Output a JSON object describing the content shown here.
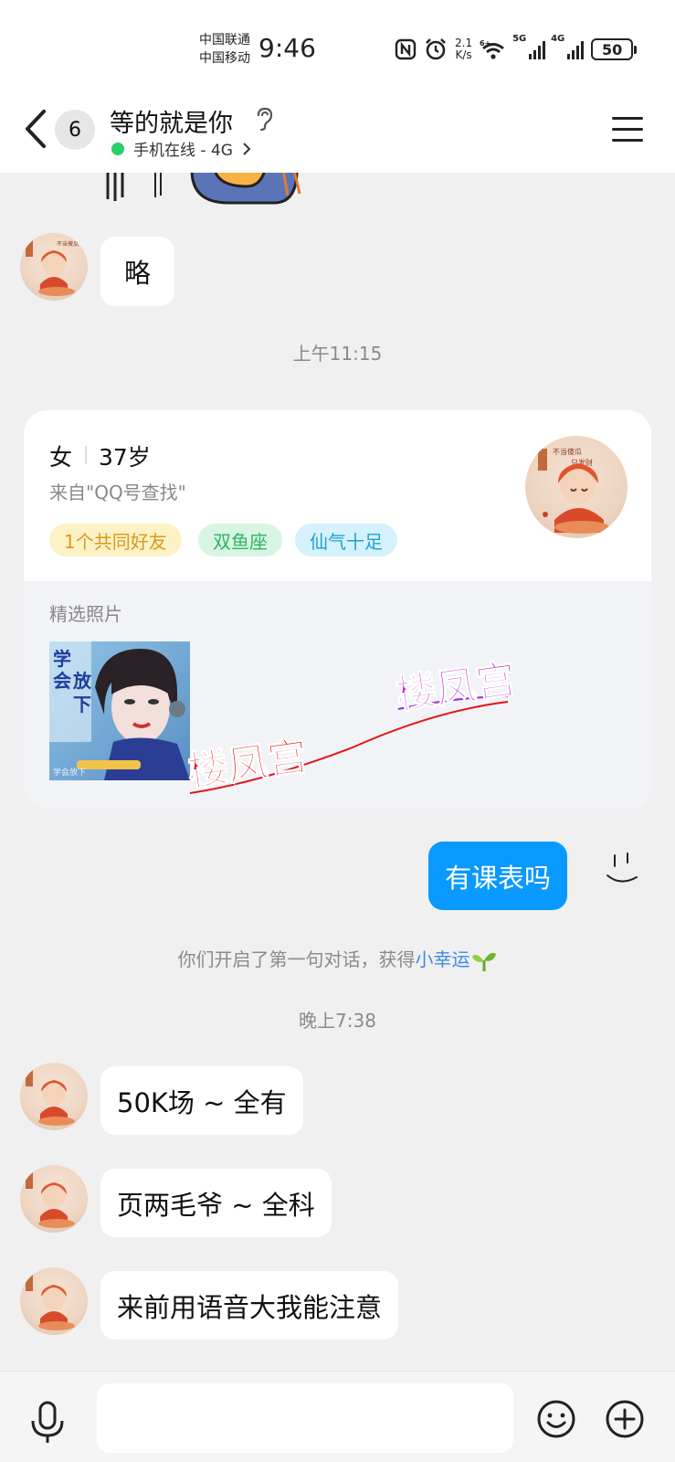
{
  "status_bar": {
    "carrier1": "中国联通",
    "carrier2": "中国移动",
    "time": "9:46",
    "speed_value": "2.1",
    "speed_unit": "K/s",
    "net1": "5G",
    "net2": "4G",
    "battery": "50"
  },
  "header": {
    "unread_count": "6",
    "contact_name": "等的就是你",
    "online_status": "手机在线 - 4G"
  },
  "messages": [
    {
      "side": "left",
      "text": "略"
    },
    {
      "type": "time",
      "text": "上午11:15"
    },
    {
      "side": "right",
      "text": "有课表吗"
    },
    {
      "type": "time",
      "text": "晚上7:38"
    },
    {
      "side": "left",
      "text": "50K场 ~ 全有"
    },
    {
      "side": "left",
      "text": "页两毛爷 ~ 全科"
    },
    {
      "side": "left",
      "text": "来前用语音大我能注意"
    }
  ],
  "profile_card": {
    "gender": "女",
    "age": "37岁",
    "source": "来自\"QQ号查找\"",
    "tags": [
      "1个共同好友",
      "双鱼座",
      "仙气十足"
    ],
    "tag_colors": [
      "#d79a19",
      "#2fb464",
      "#1ca4d3"
    ],
    "photos_title": "精选照片",
    "overlay_text": [
      "楼凤宫",
      "楼凤宫"
    ],
    "photo_text": [
      "学",
      "会",
      "放",
      "下",
      "学会放下"
    ]
  },
  "system_message": {
    "text": "你们开启了第一句对话，获得",
    "highlight": "小幸运"
  },
  "input": {
    "placeholder": ""
  },
  "colors": {
    "bubble_me": "#0a99ff",
    "online": "#2bcf6a",
    "background": "#f0f0f0"
  },
  "icons": [
    "back-arrow-icon",
    "ear-icon",
    "menu-icon",
    "mic-icon",
    "emoji-icon",
    "plus-icon",
    "nfc-icon",
    "alarm-icon",
    "wifi-icon"
  ]
}
